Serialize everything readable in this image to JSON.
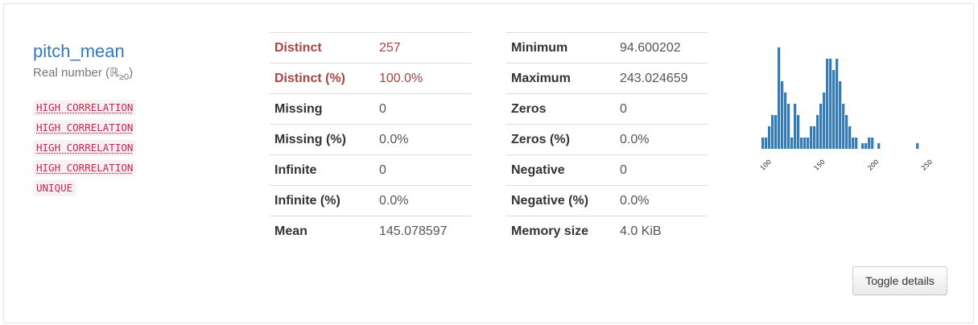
{
  "variable": {
    "name": "pitch_mean",
    "type_label": "Real number (",
    "type_symbol": "ℝ",
    "type_sub": "≥0",
    "type_close": ")",
    "badges": [
      "HIGH CORRELATION",
      "HIGH CORRELATION",
      "HIGH CORRELATION",
      "HIGH CORRELATION",
      "UNIQUE"
    ]
  },
  "stats_left": [
    {
      "label": "Distinct",
      "value": "257",
      "alert": true
    },
    {
      "label": "Distinct (%)",
      "value": "100.0%",
      "alert": true
    },
    {
      "label": "Missing",
      "value": "0"
    },
    {
      "label": "Missing (%)",
      "value": "0.0%"
    },
    {
      "label": "Infinite",
      "value": "0"
    },
    {
      "label": "Infinite (%)",
      "value": "0.0%"
    },
    {
      "label": "Mean",
      "value": "145.078597"
    }
  ],
  "stats_right": [
    {
      "label": "Minimum",
      "value": "94.600202"
    },
    {
      "label": "Maximum",
      "value": "243.024659"
    },
    {
      "label": "Zeros",
      "value": "0"
    },
    {
      "label": "Zeros (%)",
      "value": "0.0%"
    },
    {
      "label": "Negative",
      "value": "0"
    },
    {
      "label": "Negative (%)",
      "value": "0.0%"
    },
    {
      "label": "Memory size",
      "value": "4.0 KiB"
    }
  ],
  "toggle_label": "Toggle details",
  "colors": {
    "bar": "#337ab7",
    "alert": "#a94442",
    "link": "#337ab7"
  },
  "chart_data": {
    "type": "bar",
    "xlim": [
      94.6,
      243.0
    ],
    "xticks": [
      100,
      150,
      200,
      250
    ],
    "bins": [
      {
        "x": 94.6,
        "count": 1
      },
      {
        "x": 97.6,
        "count": 1
      },
      {
        "x": 100.6,
        "count": 2
      },
      {
        "x": 103.6,
        "count": 3
      },
      {
        "x": 106.6,
        "count": 3
      },
      {
        "x": 109.6,
        "count": 9
      },
      {
        "x": 112.6,
        "count": 6
      },
      {
        "x": 115.6,
        "count": 5
      },
      {
        "x": 118.6,
        "count": 4
      },
      {
        "x": 121.6,
        "count": 1
      },
      {
        "x": 124.6,
        "count": 4
      },
      {
        "x": 127.6,
        "count": 3
      },
      {
        "x": 130.6,
        "count": 1
      },
      {
        "x": 133.6,
        "count": 1
      },
      {
        "x": 136.6,
        "count": 1
      },
      {
        "x": 139.6,
        "count": 2
      },
      {
        "x": 142.6,
        "count": 2
      },
      {
        "x": 145.6,
        "count": 3
      },
      {
        "x": 148.6,
        "count": 4
      },
      {
        "x": 151.6,
        "count": 5
      },
      {
        "x": 154.6,
        "count": 8
      },
      {
        "x": 157.6,
        "count": 8
      },
      {
        "x": 160.6,
        "count": 7
      },
      {
        "x": 163.6,
        "count": 8
      },
      {
        "x": 166.6,
        "count": 6
      },
      {
        "x": 169.6,
        "count": 4
      },
      {
        "x": 172.6,
        "count": 3
      },
      {
        "x": 175.6,
        "count": 2
      },
      {
        "x": 178.6,
        "count": 1
      },
      {
        "x": 181.6,
        "count": 1
      },
      {
        "x": 187.6,
        "count": 0.5
      },
      {
        "x": 190.6,
        "count": 0.5
      },
      {
        "x": 193.6,
        "count": 1
      },
      {
        "x": 196.6,
        "count": 1
      },
      {
        "x": 202.6,
        "count": 0.5
      },
      {
        "x": 238.6,
        "count": 0.5
      }
    ]
  }
}
